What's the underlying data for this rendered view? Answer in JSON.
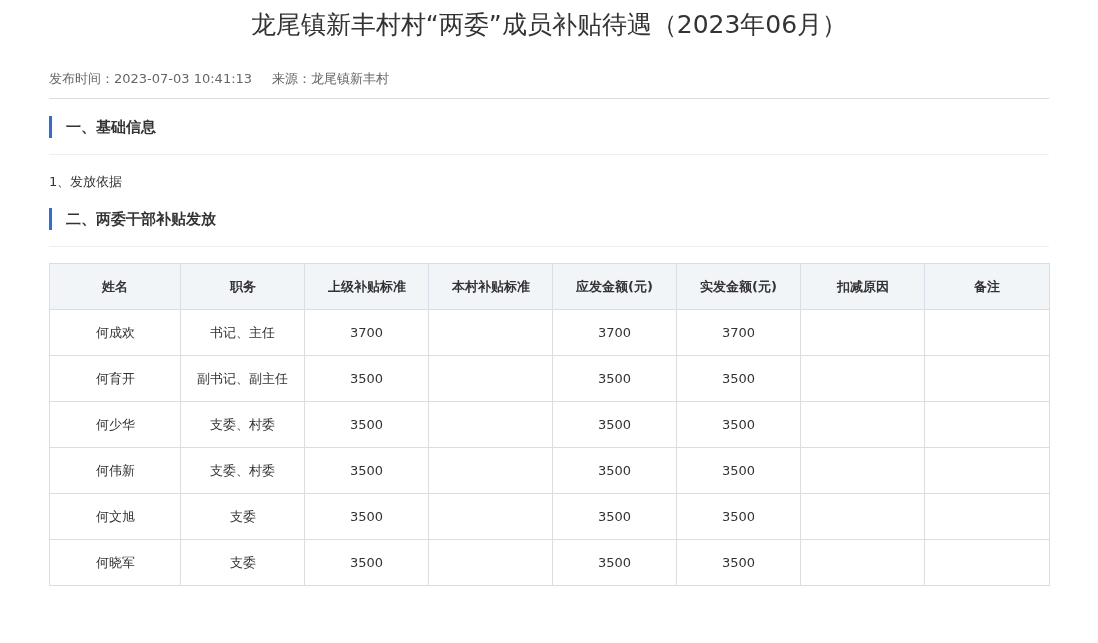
{
  "title": "龙尾镇新丰村村“两委”成员补贴待遇（2023年06月）",
  "meta": [
    {
      "label": "发布时间：",
      "value": "2023-07-03 10:41:13"
    },
    {
      "label": "来源：",
      "value": "龙尾镇新丰村"
    }
  ],
  "sections": [
    {
      "heading": "一、基础信息",
      "items": [
        "1、发放依据"
      ]
    },
    {
      "heading": "二、两委干部补贴发放"
    }
  ],
  "table": {
    "columns": [
      "姓名",
      "职务",
      "上级补贴标准",
      "本村补贴标准",
      "应发金额(元)",
      "实发金额(元)",
      "扣减原因",
      "备注"
    ],
    "rows": [
      [
        "何成欢",
        "书记、主任",
        "3700",
        "",
        "3700",
        "3700",
        "",
        ""
      ],
      [
        "何育开",
        "副书记、副主任",
        "3500",
        "",
        "3500",
        "3500",
        "",
        ""
      ],
      [
        "何少华",
        "支委、村委",
        "3500",
        "",
        "3500",
        "3500",
        "",
        ""
      ],
      [
        "何伟新",
        "支委、村委",
        "3500",
        "",
        "3500",
        "3500",
        "",
        ""
      ],
      [
        "何文旭",
        "支委",
        "3500",
        "",
        "3500",
        "3500",
        "",
        ""
      ],
      [
        "何晓军",
        "支委",
        "3500",
        "",
        "3500",
        "3500",
        "",
        ""
      ]
    ]
  }
}
